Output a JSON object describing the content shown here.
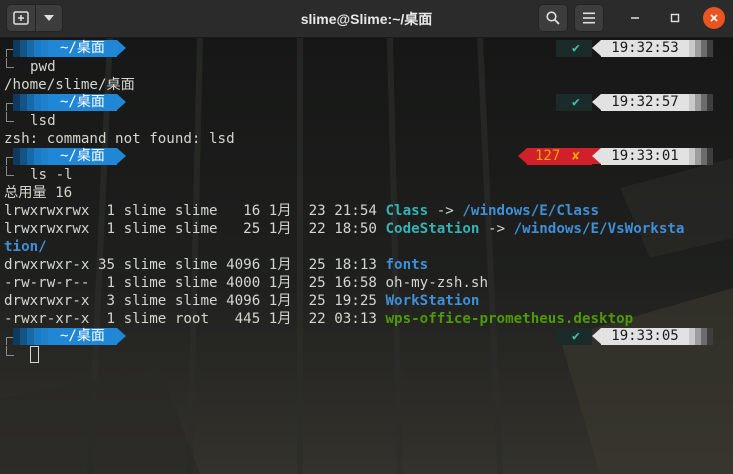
{
  "titlebar": {
    "title": "slime@Slime:~/桌面"
  },
  "icons": {
    "new_tab": "new-tab-icon",
    "menu": "chevron-down-icon",
    "search": "search-icon",
    "hamburger": "hamburger-menu-icon",
    "minimize": "minimize-icon",
    "maximize": "maximize-icon",
    "close": "close-icon"
  },
  "colors": {
    "prompt_dir_bg": "#1f87d6",
    "time_bg": "#e2e2e2",
    "ok_check": "#44c0a8",
    "error_bg": "#d1202a",
    "error_text": "#e9a600",
    "symlink": "#06989a",
    "directory": "#3f8fd8",
    "executable": "#4e9a06"
  },
  "prompts": [
    {
      "dir": "~/桌面",
      "status": "✔",
      "error_code": "",
      "time": "19:32:53",
      "command": "pwd"
    },
    {
      "dir": "~/桌面",
      "status": "✔",
      "error_code": "",
      "time": "19:32:57",
      "command": "lsd"
    },
    {
      "dir": "~/桌面",
      "status": "✘",
      "error_code": "127",
      "time": "19:33:01",
      "command": "ls -l"
    },
    {
      "dir": "~/桌面",
      "status": "✔",
      "error_code": "",
      "time": "19:33:05",
      "command": ""
    }
  ],
  "outputs": {
    "pwd": "/home/slime/桌面",
    "lsd_error": "zsh: command not found: lsd",
    "ls_total": "总用量 16"
  },
  "listing": [
    {
      "meta": "lrwxrwxrwx  1 slime slime   16 1月  23 21:54 ",
      "name": "Class",
      "arrow": " -> ",
      "target": "/windows/E/Class",
      "target_cont": ""
    },
    {
      "meta": "lrwxrwxrwx  1 slime slime   25 1月  22 18:50 ",
      "name": "CodeStation",
      "arrow": " -> ",
      "target": "/windows/E/VsWorksta",
      "target_cont": "tion/"
    },
    {
      "meta": "drwxrwxr-x 35 slime slime 4096 1月  25 18:13 ",
      "name": "fonts"
    },
    {
      "meta": "-rw-rw-r--  1 slime slime 4000 1月  25 16:58 ",
      "name": "oh-my-zsh.sh"
    },
    {
      "meta": "drwxrwxr-x  3 slime slime 4096 1月  25 19:25 ",
      "name": "WorkStation"
    },
    {
      "meta": "-rwxr-xr-x  1 slime root   445 1月  22 03:13 ",
      "name": "wps-office-prometheus.desktop"
    }
  ]
}
